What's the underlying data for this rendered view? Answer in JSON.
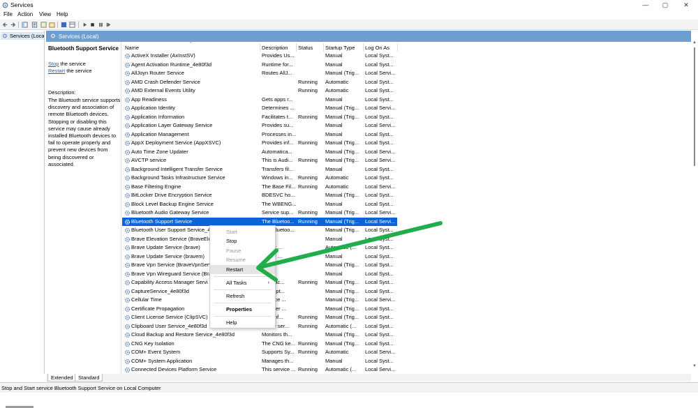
{
  "window": {
    "title": "Services",
    "controls": {
      "minimize": "—",
      "maximize": "▢",
      "close": "✕"
    }
  },
  "menu": [
    "File",
    "Action",
    "View",
    "Help"
  ],
  "tree": {
    "item": "Services (Loca"
  },
  "content_header": "Services (Local)",
  "description_pane": {
    "title": "Bluetooth Support Service",
    "stop_link": "Stop",
    "stop_suffix": " the service",
    "restart_link": "Restart",
    "restart_suffix": " the service",
    "description_label": "Description:",
    "description_text": "The Bluetooth service supports discovery and association of remote Bluetooth devices.  Stopping or disabling this service may cause already installed Bluetooth devices to fail to operate properly and prevent new devices from being discovered or associated."
  },
  "columns": [
    "Name",
    "Description",
    "Status",
    "Startup Type",
    "Log On As"
  ],
  "services": [
    [
      "ActiveX Installer (AxInstSV)",
      "Provides Us...",
      "",
      "Manual",
      "Local Syst..."
    ],
    [
      "Agent Activation Runtime_4e80f3d",
      "Runtime for...",
      "",
      "Manual",
      "Local Syst..."
    ],
    [
      "AllJoyn Router Service",
      "Routes AllJ...",
      "",
      "Manual (Trig...",
      "Local Servi..."
    ],
    [
      "AMD Crash Defender Service",
      "",
      "Running",
      "Automatic",
      "Local Syst..."
    ],
    [
      "AMD External Events Utility",
      "",
      "Running",
      "Automatic",
      "Local Syst..."
    ],
    [
      "App Readiness",
      "Gets apps r...",
      "",
      "Manual",
      "Local Syst..."
    ],
    [
      "Application Identity",
      "Determines ...",
      "",
      "Manual (Trig...",
      "Local Servi..."
    ],
    [
      "Application Information",
      "Facilitates t...",
      "Running",
      "Manual (Trig...",
      "Local Syst..."
    ],
    [
      "Application Layer Gateway Service",
      "Provides su...",
      "",
      "Manual",
      "Local Servi..."
    ],
    [
      "Application Management",
      "Processes in...",
      "",
      "Manual",
      "Local Syst..."
    ],
    [
      "AppX Deployment Service (AppXSVC)",
      "Provides inf...",
      "Running",
      "Manual (Trig...",
      "Local Syst..."
    ],
    [
      "Auto Time Zone Updater",
      "Automatica...",
      "",
      "Manual (Trig...",
      "Local Servi..."
    ],
    [
      "AVCTP service",
      "This is Audi...",
      "Running",
      "Manual (Trig...",
      "Local Servi..."
    ],
    [
      "Background Intelligent Transfer Service",
      "Transfers fil...",
      "",
      "Manual",
      "Local Syst..."
    ],
    [
      "Background Tasks Infrastructure Service",
      "Windows in...",
      "Running",
      "Automatic",
      "Local Syst..."
    ],
    [
      "Base Filtering Engine",
      "The Base Fil...",
      "Running",
      "Automatic",
      "Local Servi..."
    ],
    [
      "BitLocker Drive Encryption Service",
      "BDESVC ho...",
      "",
      "Manual (Trig...",
      "Local Syst..."
    ],
    [
      "Block Level Backup Engine Service",
      "The WBENG...",
      "",
      "Manual",
      "Local Syst..."
    ],
    [
      "Bluetooth Audio Gateway Service",
      "Service sup...",
      "Running",
      "Manual (Trig...",
      "Local Servi..."
    ],
    [
      "Bluetooth Support Service",
      "The Bluetoo...",
      "Running",
      "Manual (Trig...",
      "Local Servi..."
    ],
    [
      "Bluetooth User Support Service_4",
      "The Bluetoo...",
      "",
      "Manual (Trig...",
      "Local Syst..."
    ],
    [
      "Brave Elevation Service (BraveEle",
      "",
      "",
      "Manual",
      "Local Syst..."
    ],
    [
      "Brave Update Service (brave)",
      "...your ...",
      "",
      "Automatic (...",
      "Local Syst..."
    ],
    [
      "Brave Update Service (bravem)",
      "...your ...",
      "",
      "Manual",
      "Local Syst..."
    ],
    [
      "Brave Vpn Service (BraveVpnServ",
      "",
      "",
      "Manual (Trig...",
      "Local Syst..."
    ],
    [
      "Brave Vpn Wireguard Service (Bra",
      "",
      "",
      "Manual",
      "Local Syst..."
    ],
    [
      "Capability Access Manager Servi",
      "...es fac...",
      "Running",
      "Manual (Trig...",
      "Local Syst..."
    ],
    [
      "CaptureService_4e80f3d",
      "...es opt...",
      "",
      "Manual (Trig...",
      "Local Syst..."
    ],
    [
      "Cellular Time",
      "...ervice ...",
      "",
      "Manual (Trig...",
      "Local Servi..."
    ],
    [
      "Certificate Propagation",
      "...s user ...",
      "",
      "Manual (Trig...",
      "Local Syst..."
    ],
    [
      "Client License Service (ClipSVC)",
      "...es inf...",
      "Running",
      "Manual (Trig...",
      "Local Syst..."
    ],
    [
      "Clipboard User Service_4e80f3d",
      "...user ser...",
      "Running",
      "Automatic (...",
      "Local Syst..."
    ],
    [
      "Cloud Backup and Restore Service_4e80f3d",
      "Monitors th...",
      "",
      "Manual (Trig...",
      "Local Syst..."
    ],
    [
      "CNG Key Isolation",
      "The CNG ke...",
      "Running",
      "Manual (Trig...",
      "Local Syst..."
    ],
    [
      "COM+ Event System",
      "Supports Sy...",
      "Running",
      "Automatic",
      "Local Servi..."
    ],
    [
      "COM+ System Application",
      "Manages th...",
      "",
      "Manual",
      "Local Syst..."
    ],
    [
      "Connected Devices Platform Service",
      "This service ...",
      "Running",
      "Automatic (...",
      "Local Servi..."
    ]
  ],
  "selected_service": "Bluetooth Support Service",
  "context_menu": {
    "start": "Start",
    "stop": "Stop",
    "pause": "Pause",
    "resume": "Resume",
    "restart": "Restart",
    "all_tasks": "All Tasks",
    "refresh": "Refresh",
    "properties": "Properties",
    "help": "Help"
  },
  "tabs": {
    "extended": "Extended",
    "standard": "Standard"
  },
  "status_bar": "Stop and Start service Bluetooth Support Service on Local Computer",
  "colors": {
    "selection": "#0a64d8",
    "header_band": "#6f9ed1",
    "arrow": "#1fae4b",
    "link": "#1a5fb4"
  },
  "icons": [
    "services-icon",
    "gear-icon",
    "back-icon",
    "forward-icon",
    "play-icon",
    "stop-icon",
    "pause-icon",
    "restart-icon"
  ]
}
